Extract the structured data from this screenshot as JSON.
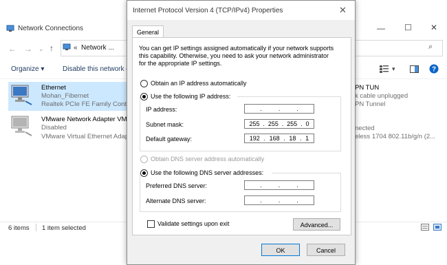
{
  "nc": {
    "title": "Network Connections",
    "breadcrumb_prefix": "«",
    "breadcrumb": "Network ...",
    "toolbar": {
      "organize": "Organize",
      "disable": "Disable this network d"
    },
    "items": [
      {
        "name": "Ethernet",
        "line2": "Mohan_Fibernet",
        "line3": "Realtek PCIe FE Family Contro"
      },
      {
        "name": "VMware Network Adapter VM",
        "line2": "Disabled",
        "line3": "VMware Virtual Ethernet Adap"
      }
    ],
    "right_items": [
      {
        "line1": "PN TUN",
        "line2": "k cable unplugged",
        "line3": "PN Tunnel"
      },
      {
        "line1": "nected",
        "line2": "eless 1704 802.11b/g/n (2..."
      }
    ],
    "status": {
      "count": "6 items",
      "selected": "1 item selected"
    }
  },
  "dialog": {
    "title": "Internet Protocol Version 4 (TCP/IPv4) Properties",
    "tab": "General",
    "intro": [
      "You can get IP settings assigned automatically if your network supports",
      "this capability. Otherwise, you need to ask your network administrator",
      "for the appropriate IP settings."
    ],
    "ip_auto": "Obtain an IP address automatically",
    "ip_manual": "Use the following IP address:",
    "ip_address_label": "IP address:",
    "subnet_label": "Subnet mask:",
    "gateway_label": "Default gateway:",
    "ip_address": [
      "",
      "",
      "",
      ""
    ],
    "subnet": [
      "255",
      "255",
      "255",
      "0"
    ],
    "gateway": [
      "192",
      "168",
      "18",
      "1"
    ],
    "dns_auto": "Obtain DNS server address automatically",
    "dns_manual": "Use the following DNS server addresses:",
    "preferred_label": "Preferred DNS server:",
    "alternate_label": "Alternate DNS server:",
    "preferred": [
      "",
      "",
      "",
      ""
    ],
    "alternate": [
      "",
      "",
      "",
      ""
    ],
    "validate": "Validate settings upon exit",
    "advanced": "Advanced...",
    "ok": "OK",
    "cancel": "Cancel",
    "selected_ip_mode": "manual",
    "selected_dns_mode": "manual",
    "validate_checked": false
  },
  "colors": {
    "accent": "#0078d7",
    "selected_row": "#cce8ff",
    "help_icon": "#0a64c8"
  }
}
